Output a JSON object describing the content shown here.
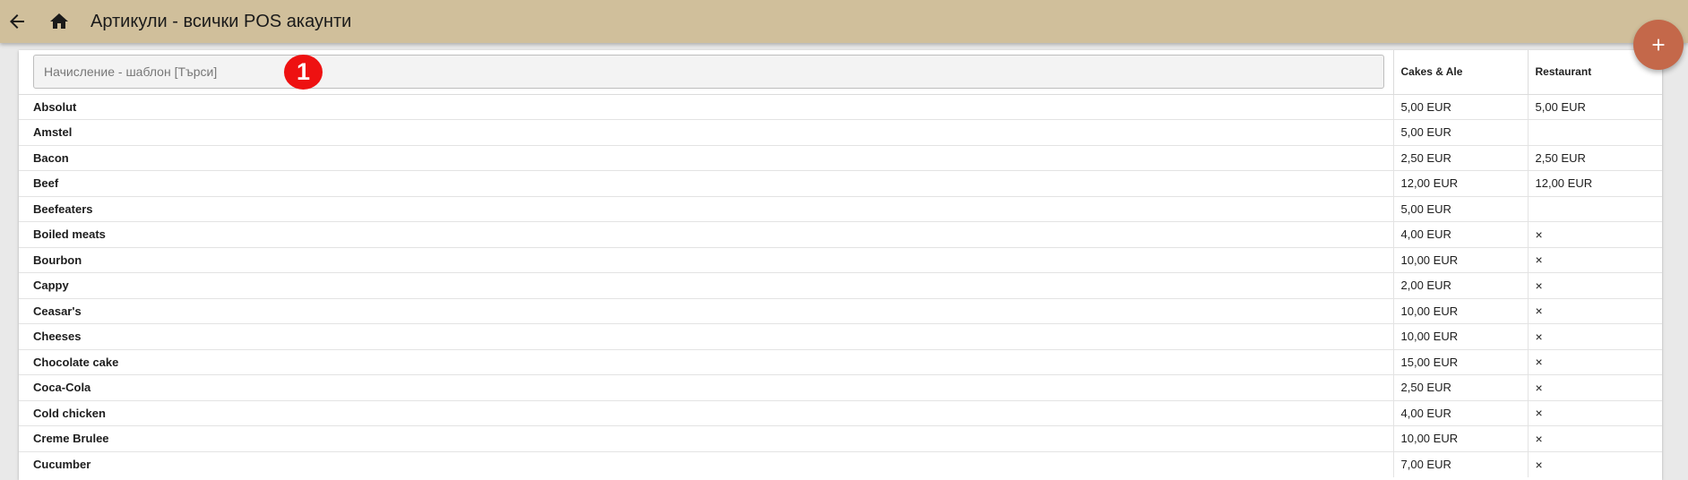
{
  "header": {
    "title": "Артикули - всички POS акаунти"
  },
  "colors": {
    "topbar": "#d0bf9b",
    "fab": "#c4684a",
    "badge": "#ee1111"
  },
  "icons": {
    "back": "arrow-left-icon",
    "home": "home-icon",
    "add": "plus-icon"
  },
  "search": {
    "placeholder": "Начисление - шаблон [Търси]",
    "value": ""
  },
  "annotation": {
    "badge": "1"
  },
  "table": {
    "columns": [
      "Cakes & Ale",
      "Restaurant"
    ],
    "rows": [
      {
        "name": "Absolut",
        "c1": "5,00 EUR",
        "c2": "5,00 EUR"
      },
      {
        "name": "Amstel",
        "c1": "5,00 EUR",
        "c2": ""
      },
      {
        "name": "Bacon",
        "c1": "2,50 EUR",
        "c2": "2,50 EUR"
      },
      {
        "name": "Beef",
        "c1": "12,00 EUR",
        "c2": "12,00 EUR"
      },
      {
        "name": "Beefeaters",
        "c1": "5,00 EUR",
        "c2": ""
      },
      {
        "name": "Boiled meats",
        "c1": "4,00 EUR",
        "c2": "×"
      },
      {
        "name": "Bourbon",
        "c1": "10,00 EUR",
        "c2": "×"
      },
      {
        "name": "Cappy",
        "c1": "2,00 EUR",
        "c2": "×"
      },
      {
        "name": "Ceasar's",
        "c1": "10,00 EUR",
        "c2": "×"
      },
      {
        "name": "Cheeses",
        "c1": "10,00 EUR",
        "c2": "×"
      },
      {
        "name": "Chocolate cake",
        "c1": "15,00 EUR",
        "c2": "×"
      },
      {
        "name": "Coca-Cola",
        "c1": "2,50 EUR",
        "c2": "×"
      },
      {
        "name": "Cold chicken",
        "c1": "4,00 EUR",
        "c2": "×"
      },
      {
        "name": "Creme Brulee",
        "c1": "10,00 EUR",
        "c2": "×"
      },
      {
        "name": "Cucumber",
        "c1": "7,00 EUR",
        "c2": "×"
      }
    ]
  }
}
